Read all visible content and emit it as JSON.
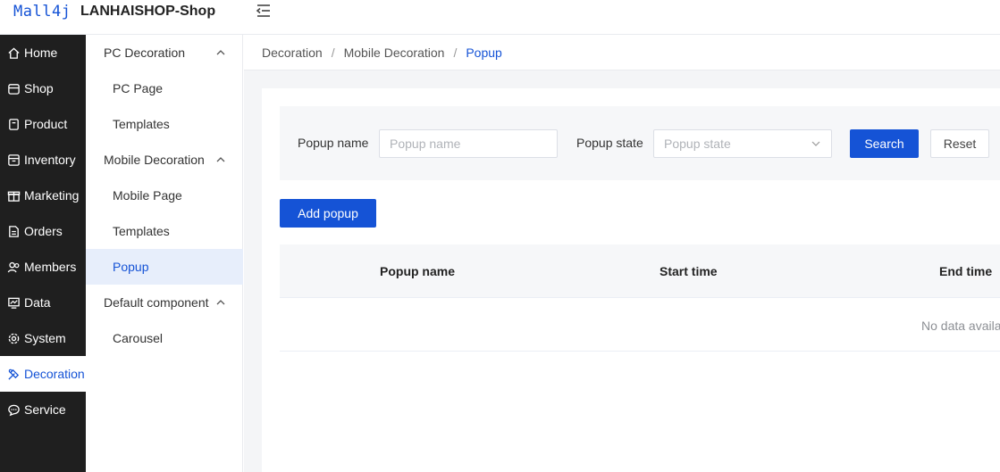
{
  "header": {
    "logo": "Mall4j",
    "shop_name": "LANHAISHOP-Shop"
  },
  "sidebar": {
    "items": [
      {
        "label": "Home",
        "icon": "home-icon"
      },
      {
        "label": "Shop",
        "icon": "shop-icon"
      },
      {
        "label": "Product",
        "icon": "product-icon"
      },
      {
        "label": "Inventory",
        "icon": "inventory-icon"
      },
      {
        "label": "Marketing",
        "icon": "gift-icon"
      },
      {
        "label": "Orders",
        "icon": "orders-icon"
      },
      {
        "label": "Members",
        "icon": "members-icon"
      },
      {
        "label": "Data",
        "icon": "data-icon"
      },
      {
        "label": "System",
        "icon": "gear-icon"
      },
      {
        "label": "Decoration",
        "icon": "decoration-icon",
        "active": true
      },
      {
        "label": "Service",
        "icon": "chat-icon"
      }
    ]
  },
  "submenu": {
    "groups": [
      {
        "label": "PC Decoration",
        "items": [
          "PC Page",
          "Templates"
        ]
      },
      {
        "label": "Mobile Decoration",
        "items": [
          "Mobile Page",
          "Templates",
          "Popup"
        ]
      },
      {
        "label": "Default component",
        "items": [
          "Carousel"
        ]
      }
    ],
    "active_item": "Popup"
  },
  "breadcrumb": [
    "Decoration",
    "Mobile Decoration",
    "Popup"
  ],
  "search": {
    "name_label": "Popup name",
    "name_placeholder": "Popup name",
    "state_label": "Popup state",
    "state_placeholder": "Popup state",
    "search_button": "Search",
    "reset_button": "Reset"
  },
  "add_button": "Add popup",
  "table": {
    "columns": [
      "Popup name",
      "Start time",
      "End time"
    ],
    "empty_text": "No data available"
  },
  "colors": {
    "accent": "#1553d6",
    "sidebar_bg": "#1f1f1f"
  }
}
